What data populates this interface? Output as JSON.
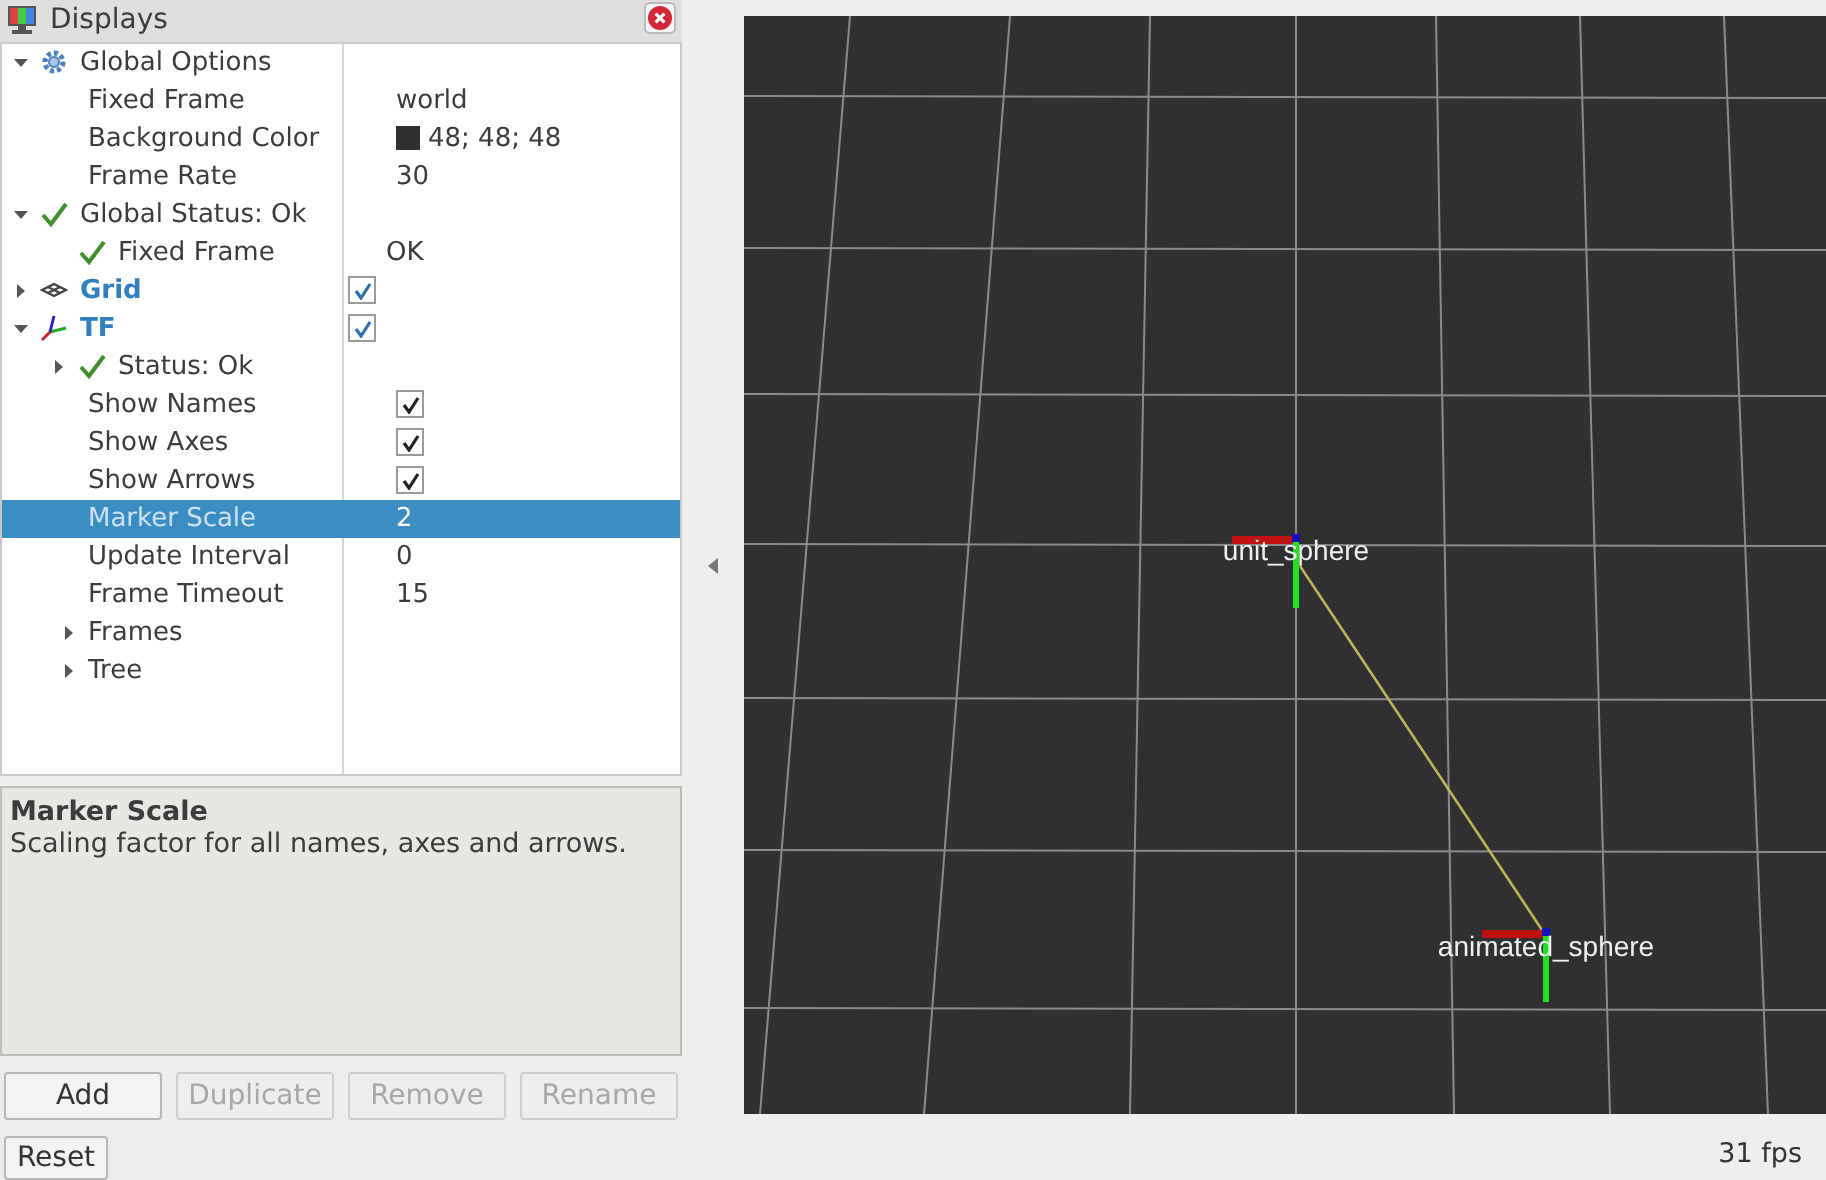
{
  "panel": {
    "title": "Displays"
  },
  "tree": [
    {
      "label": "Global Options",
      "kind": "options",
      "expanded": true,
      "selected": false,
      "children": [
        {
          "label": "Fixed Frame",
          "kind": "property",
          "value": "world",
          "selected": false
        },
        {
          "label": "Background Color",
          "kind": "property",
          "value": "48; 48; 48",
          "color": "#303030",
          "selected": false
        },
        {
          "label": "Frame Rate",
          "kind": "property",
          "value": "30",
          "selected": false
        }
      ]
    },
    {
      "label": "Global Status: Ok",
      "kind": "status",
      "expanded": true,
      "selected": false,
      "children": [
        {
          "label": "Fixed Frame",
          "kind": "status",
          "value": "OK",
          "selected": false
        }
      ]
    },
    {
      "label": "Grid",
      "kind": "display",
      "expanded": false,
      "checked": true,
      "selected": false
    },
    {
      "label": "TF",
      "kind": "display",
      "expanded": true,
      "checked": true,
      "selected": false,
      "children": [
        {
          "label": "Status: Ok",
          "kind": "status",
          "expanded": false,
          "selected": false
        },
        {
          "label": "Show Names",
          "kind": "property",
          "checked": true,
          "selected": false
        },
        {
          "label": "Show Axes",
          "kind": "property",
          "checked": true,
          "selected": false
        },
        {
          "label": "Show Arrows",
          "kind": "property",
          "checked": true,
          "selected": false
        },
        {
          "label": "Marker Scale",
          "kind": "property",
          "value": "2",
          "selected": true
        },
        {
          "label": "Update Interval",
          "kind": "property",
          "value": "0",
          "selected": false
        },
        {
          "label": "Frame Timeout",
          "kind": "property",
          "value": "15",
          "selected": false
        },
        {
          "label": "Frames",
          "kind": "group",
          "expanded": false,
          "selected": false
        },
        {
          "label": "Tree",
          "kind": "group",
          "expanded": false,
          "selected": false
        }
      ]
    }
  ],
  "description": {
    "title": "Marker Scale",
    "text": "Scaling factor for all names, axes and arrows."
  },
  "buttons": [
    {
      "label": "Add",
      "disabled": false
    },
    {
      "label": "Duplicate",
      "disabled": true
    },
    {
      "label": "Remove",
      "disabled": true
    },
    {
      "label": "Rename",
      "disabled": true
    }
  ],
  "reset": {
    "label": "Reset"
  },
  "view": {
    "frames": [
      {
        "name": "unit_sphere"
      },
      {
        "name": "animated_sphere"
      }
    ]
  },
  "status_bar": {
    "fps": "31 fps"
  }
}
